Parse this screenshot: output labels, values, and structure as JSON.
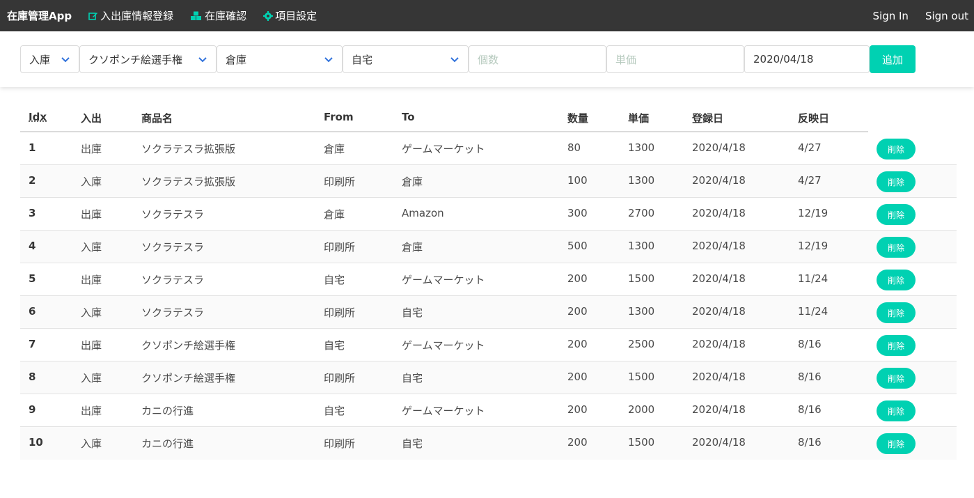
{
  "navbar": {
    "brand": "在庫管理App",
    "items": [
      {
        "label": "入出庫情報登録",
        "icon": "edit-icon"
      },
      {
        "label": "在庫確認",
        "icon": "cubes-icon"
      },
      {
        "label": "項目設定",
        "icon": "gear-icon"
      }
    ],
    "sign_in": "Sign In",
    "sign_out": "Sign out"
  },
  "form": {
    "direction": "入庫",
    "product": "クソポンチ絵選手権",
    "from": "倉庫",
    "to": "自宅",
    "quantity_placeholder": "個数",
    "price_placeholder": "単価",
    "date": "2020/04/18",
    "add_label": "追加"
  },
  "table": {
    "headers": {
      "idx": "Idx",
      "direction": "入出",
      "product": "商品名",
      "from": "From",
      "to": "To",
      "qty": "数量",
      "price": "単価",
      "registered": "登録日",
      "reflected": "反映日"
    },
    "delete_label": "削除",
    "rows": [
      {
        "idx": "1",
        "direction": "出庫",
        "product": "ソクラテスラ拡張版",
        "from": "倉庫",
        "to": "ゲームマーケット",
        "qty": "80",
        "price": "1300",
        "registered": "2020/4/18",
        "reflected": "4/27"
      },
      {
        "idx": "2",
        "direction": "入庫",
        "product": "ソクラテスラ拡張版",
        "from": "印刷所",
        "to": "倉庫",
        "qty": "100",
        "price": "1300",
        "registered": "2020/4/18",
        "reflected": "4/27"
      },
      {
        "idx": "3",
        "direction": "出庫",
        "product": "ソクラテスラ",
        "from": "倉庫",
        "to": "Amazon",
        "qty": "300",
        "price": "2700",
        "registered": "2020/4/18",
        "reflected": "12/19"
      },
      {
        "idx": "4",
        "direction": "入庫",
        "product": "ソクラテスラ",
        "from": "印刷所",
        "to": "倉庫",
        "qty": "500",
        "price": "1300",
        "registered": "2020/4/18",
        "reflected": "12/19"
      },
      {
        "idx": "5",
        "direction": "出庫",
        "product": "ソクラテスラ",
        "from": "自宅",
        "to": "ゲームマーケット",
        "qty": "200",
        "price": "1500",
        "registered": "2020/4/18",
        "reflected": "11/24"
      },
      {
        "idx": "6",
        "direction": "入庫",
        "product": "ソクラテスラ",
        "from": "印刷所",
        "to": "自宅",
        "qty": "200",
        "price": "1300",
        "registered": "2020/4/18",
        "reflected": "11/24"
      },
      {
        "idx": "7",
        "direction": "出庫",
        "product": "クソポンチ絵選手権",
        "from": "自宅",
        "to": "ゲームマーケット",
        "qty": "200",
        "price": "2500",
        "registered": "2020/4/18",
        "reflected": "8/16"
      },
      {
        "idx": "8",
        "direction": "入庫",
        "product": "クソポンチ絵選手権",
        "from": "印刷所",
        "to": "自宅",
        "qty": "200",
        "price": "1500",
        "registered": "2020/4/18",
        "reflected": "8/16"
      },
      {
        "idx": "9",
        "direction": "出庫",
        "product": "カニの行進",
        "from": "自宅",
        "to": "ゲームマーケット",
        "qty": "200",
        "price": "2000",
        "registered": "2020/4/18",
        "reflected": "8/16"
      },
      {
        "idx": "10",
        "direction": "入庫",
        "product": "カニの行進",
        "from": "印刷所",
        "to": "自宅",
        "qty": "200",
        "price": "1500",
        "registered": "2020/4/18",
        "reflected": "8/16"
      }
    ]
  },
  "colors": {
    "navbar_bg": "#363636",
    "accent": "#00d1b2",
    "select_arrow": "#3273dc"
  }
}
